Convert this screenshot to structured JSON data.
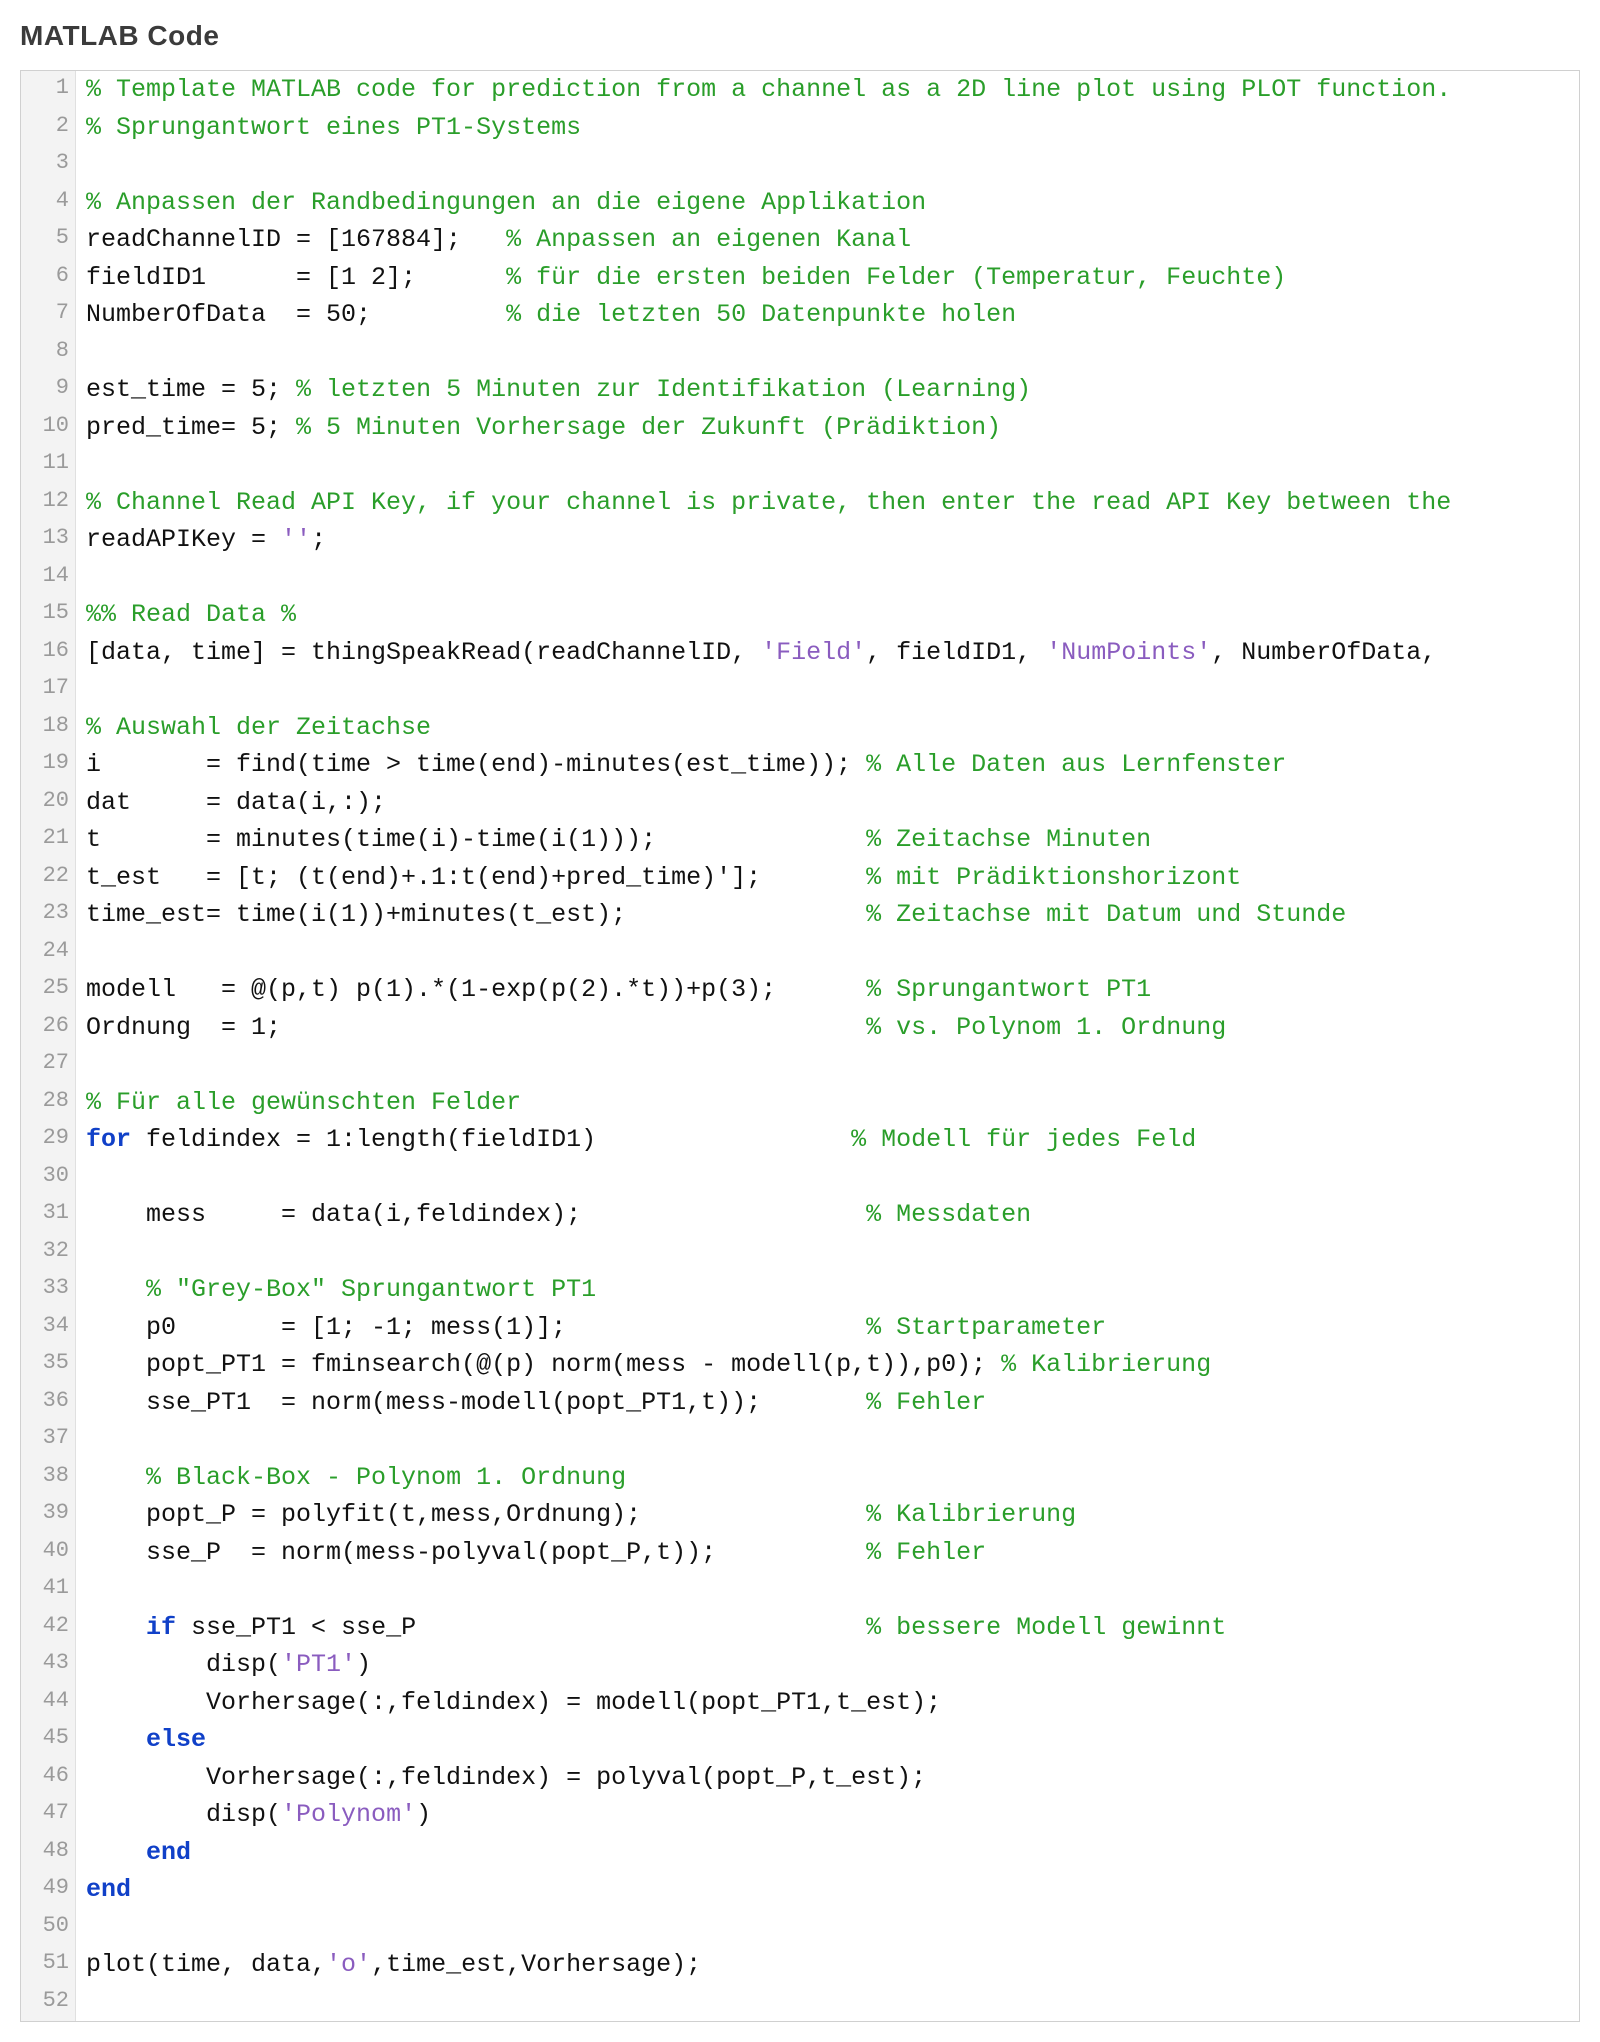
{
  "title": "MATLAB Code",
  "lines": [
    {
      "n": 1,
      "tokens": [
        {
          "t": "% Template MATLAB code for prediction from a channel as a 2D line plot using PLOT function.",
          "cls": "c"
        }
      ]
    },
    {
      "n": 2,
      "tokens": [
        {
          "t": "% Sprungantwort eines PT1-Systems",
          "cls": "c"
        }
      ]
    },
    {
      "n": 3,
      "tokens": [
        {
          "t": " ",
          "cls": ""
        }
      ]
    },
    {
      "n": 4,
      "tokens": [
        {
          "t": "% Anpassen der Randbedingungen an die eigene Applikation",
          "cls": "c"
        }
      ]
    },
    {
      "n": 5,
      "tokens": [
        {
          "t": "readChannelID = [167884];   ",
          "cls": ""
        },
        {
          "t": "% Anpassen an eigenen Kanal",
          "cls": "c"
        }
      ]
    },
    {
      "n": 6,
      "tokens": [
        {
          "t": "fieldID1      = [1 2];      ",
          "cls": ""
        },
        {
          "t": "% für die ersten beiden Felder (Temperatur, Feuchte)",
          "cls": "c"
        }
      ]
    },
    {
      "n": 7,
      "tokens": [
        {
          "t": "NumberOfData  = 50;         ",
          "cls": ""
        },
        {
          "t": "% die letzten 50 Datenpunkte holen",
          "cls": "c"
        }
      ]
    },
    {
      "n": 8,
      "tokens": [
        {
          "t": " ",
          "cls": ""
        }
      ]
    },
    {
      "n": 9,
      "tokens": [
        {
          "t": "est_time = 5; ",
          "cls": ""
        },
        {
          "t": "% letzten 5 Minuten zur Identifikation (Learning)",
          "cls": "c"
        }
      ]
    },
    {
      "n": 10,
      "tokens": [
        {
          "t": "pred_time= 5; ",
          "cls": ""
        },
        {
          "t": "% 5 Minuten Vorhersage der Zukunft (Prädiktion)",
          "cls": "c"
        }
      ]
    },
    {
      "n": 11,
      "tokens": [
        {
          "t": " ",
          "cls": ""
        }
      ]
    },
    {
      "n": 12,
      "tokens": [
        {
          "t": "% Channel Read API Key, if your channel is private, then enter the read API Key between the",
          "cls": "c"
        }
      ]
    },
    {
      "n": 13,
      "tokens": [
        {
          "t": "readAPIKey = ",
          "cls": ""
        },
        {
          "t": "''",
          "cls": "s"
        },
        {
          "t": ";",
          "cls": ""
        }
      ]
    },
    {
      "n": 14,
      "tokens": [
        {
          "t": " ",
          "cls": ""
        }
      ]
    },
    {
      "n": 15,
      "tokens": [
        {
          "t": "%% Read Data %",
          "cls": "c"
        }
      ]
    },
    {
      "n": 16,
      "tokens": [
        {
          "t": "[data, time] = thingSpeakRead(readChannelID, ",
          "cls": ""
        },
        {
          "t": "'Field'",
          "cls": "s"
        },
        {
          "t": ", fieldID1, ",
          "cls": ""
        },
        {
          "t": "'NumPoints'",
          "cls": "s"
        },
        {
          "t": ", NumberOfData,",
          "cls": ""
        }
      ]
    },
    {
      "n": 17,
      "tokens": [
        {
          "t": " ",
          "cls": ""
        }
      ]
    },
    {
      "n": 18,
      "tokens": [
        {
          "t": "% Auswahl der Zeitachse",
          "cls": "c"
        }
      ]
    },
    {
      "n": 19,
      "tokens": [
        {
          "t": "i       = find(time > time(end)-minutes(est_time)); ",
          "cls": ""
        },
        {
          "t": "% Alle Daten aus Lernfenster",
          "cls": "c"
        }
      ]
    },
    {
      "n": 20,
      "tokens": [
        {
          "t": "dat     = data(i,:);",
          "cls": ""
        }
      ]
    },
    {
      "n": 21,
      "tokens": [
        {
          "t": "t       = minutes(time(i)-time(i(1)));              ",
          "cls": ""
        },
        {
          "t": "% Zeitachse Minuten",
          "cls": "c"
        }
      ]
    },
    {
      "n": 22,
      "tokens": [
        {
          "t": "t_est   = [t; (t(end)+.1:t(end)+pred_time)'];       ",
          "cls": ""
        },
        {
          "t": "% mit Prädiktionshorizont",
          "cls": "c"
        }
      ]
    },
    {
      "n": 23,
      "tokens": [
        {
          "t": "time_est= time(i(1))+minutes(t_est);                ",
          "cls": ""
        },
        {
          "t": "% Zeitachse mit Datum und Stunde",
          "cls": "c"
        }
      ]
    },
    {
      "n": 24,
      "tokens": [
        {
          "t": " ",
          "cls": ""
        }
      ]
    },
    {
      "n": 25,
      "tokens": [
        {
          "t": "modell   = @(p,t) p(1).*(1-exp(p(2).*t))+p(3);      ",
          "cls": ""
        },
        {
          "t": "% Sprungantwort PT1",
          "cls": "c"
        }
      ]
    },
    {
      "n": 26,
      "tokens": [
        {
          "t": "Ordnung  = 1;                                       ",
          "cls": ""
        },
        {
          "t": "% vs. Polynom 1. Ordnung",
          "cls": "c"
        }
      ]
    },
    {
      "n": 27,
      "tokens": [
        {
          "t": " ",
          "cls": ""
        }
      ]
    },
    {
      "n": 28,
      "tokens": [
        {
          "t": "% Für alle gewünschten Felder",
          "cls": "c"
        }
      ]
    },
    {
      "n": 29,
      "tokens": [
        {
          "t": "for",
          "cls": "k"
        },
        {
          "t": " feldindex = 1:length(fieldID1)                 ",
          "cls": ""
        },
        {
          "t": "% Modell für jedes Feld",
          "cls": "c"
        }
      ]
    },
    {
      "n": 30,
      "tokens": [
        {
          "t": " ",
          "cls": ""
        }
      ]
    },
    {
      "n": 31,
      "tokens": [
        {
          "t": "    mess     = data(i,feldindex);                   ",
          "cls": ""
        },
        {
          "t": "% Messdaten",
          "cls": "c"
        }
      ]
    },
    {
      "n": 32,
      "tokens": [
        {
          "t": " ",
          "cls": ""
        }
      ]
    },
    {
      "n": 33,
      "tokens": [
        {
          "t": "    ",
          "cls": ""
        },
        {
          "t": "% \"Grey-Box\" Sprungantwort PT1",
          "cls": "c"
        }
      ]
    },
    {
      "n": 34,
      "tokens": [
        {
          "t": "    p0       = [1; -1; mess(1)];                    ",
          "cls": ""
        },
        {
          "t": "% Startparameter",
          "cls": "c"
        }
      ]
    },
    {
      "n": 35,
      "tokens": [
        {
          "t": "    popt_PT1 = fminsearch(@(p) norm(mess - modell(p,t)),p0); ",
          "cls": ""
        },
        {
          "t": "% Kalibrierung",
          "cls": "c"
        }
      ]
    },
    {
      "n": 36,
      "tokens": [
        {
          "t": "    sse_PT1  = norm(mess-modell(popt_PT1,t));       ",
          "cls": ""
        },
        {
          "t": "% Fehler",
          "cls": "c"
        }
      ]
    },
    {
      "n": 37,
      "tokens": [
        {
          "t": " ",
          "cls": ""
        }
      ]
    },
    {
      "n": 38,
      "tokens": [
        {
          "t": "    ",
          "cls": ""
        },
        {
          "t": "% Black-Box - Polynom 1. Ordnung",
          "cls": "c"
        }
      ]
    },
    {
      "n": 39,
      "tokens": [
        {
          "t": "    popt_P = polyfit(t,mess,Ordnung);               ",
          "cls": ""
        },
        {
          "t": "% Kalibrierung",
          "cls": "c"
        }
      ]
    },
    {
      "n": 40,
      "tokens": [
        {
          "t": "    sse_P  = norm(mess-polyval(popt_P,t));          ",
          "cls": ""
        },
        {
          "t": "% Fehler",
          "cls": "c"
        }
      ]
    },
    {
      "n": 41,
      "tokens": [
        {
          "t": " ",
          "cls": ""
        }
      ]
    },
    {
      "n": 42,
      "tokens": [
        {
          "t": "    ",
          "cls": ""
        },
        {
          "t": "if",
          "cls": "k"
        },
        {
          "t": " sse_PT1 < sse_P                              ",
          "cls": ""
        },
        {
          "t": "% bessere Modell gewinnt",
          "cls": "c"
        }
      ]
    },
    {
      "n": 43,
      "tokens": [
        {
          "t": "        disp(",
          "cls": ""
        },
        {
          "t": "'PT1'",
          "cls": "s"
        },
        {
          "t": ")",
          "cls": ""
        }
      ]
    },
    {
      "n": 44,
      "tokens": [
        {
          "t": "        Vorhersage(:,feldindex) = modell(popt_PT1,t_est);",
          "cls": ""
        }
      ]
    },
    {
      "n": 45,
      "tokens": [
        {
          "t": "    ",
          "cls": ""
        },
        {
          "t": "else",
          "cls": "k"
        }
      ]
    },
    {
      "n": 46,
      "tokens": [
        {
          "t": "        Vorhersage(:,feldindex) = polyval(popt_P,t_est);",
          "cls": ""
        }
      ]
    },
    {
      "n": 47,
      "tokens": [
        {
          "t": "        disp(",
          "cls": ""
        },
        {
          "t": "'Polynom'",
          "cls": "s"
        },
        {
          "t": ")",
          "cls": ""
        }
      ]
    },
    {
      "n": 48,
      "tokens": [
        {
          "t": "    ",
          "cls": ""
        },
        {
          "t": "end",
          "cls": "k"
        }
      ]
    },
    {
      "n": 49,
      "tokens": [
        {
          "t": "end",
          "cls": "k"
        }
      ]
    },
    {
      "n": 50,
      "tokens": [
        {
          "t": " ",
          "cls": ""
        }
      ]
    },
    {
      "n": 51,
      "tokens": [
        {
          "t": "plot(time, data,",
          "cls": ""
        },
        {
          "t": "'o'",
          "cls": "s"
        },
        {
          "t": ",time_est,Vorhersage);",
          "cls": ""
        }
      ]
    },
    {
      "n": 52,
      "tokens": [
        {
          "t": " ",
          "cls": ""
        }
      ]
    }
  ]
}
